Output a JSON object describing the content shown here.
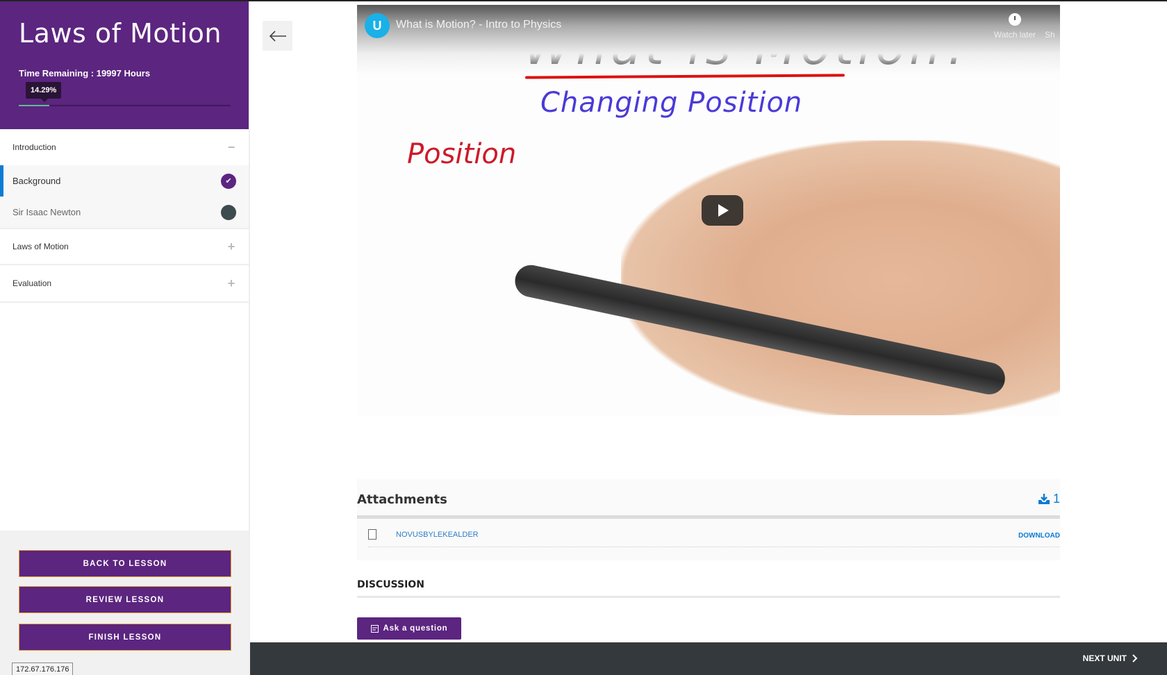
{
  "sidebar": {
    "title": "Laws of Motion",
    "time_remaining": "Time Remaining : 19997 Hours",
    "progress": {
      "percent": 14.29,
      "label": "14.29%"
    },
    "sections": [
      {
        "label": "Introduction",
        "expanded": true,
        "toggle": "−",
        "units": [
          {
            "label": "Background",
            "status": "completed",
            "active": true
          },
          {
            "label": "Sir Isaac Newton",
            "status": "incomplete",
            "active": false
          }
        ]
      },
      {
        "label": "Laws of Motion",
        "expanded": false,
        "toggle": "+"
      },
      {
        "label": "Evaluation",
        "expanded": false,
        "toggle": "+"
      }
    ],
    "buttons": {
      "back_to_lesson": "BACK TO LESSON",
      "review_lesson": "REVIEW LESSON",
      "finish_lesson": "FINISH LESSON"
    },
    "ip_address": "172.67.176.176"
  },
  "video": {
    "title": "What is Motion? - Intro to Physics",
    "watch_later": "Watch later",
    "share": "Sh",
    "whiteboard": {
      "heading": "What is Motion?",
      "subheading": "Changing Position",
      "note": "Position"
    }
  },
  "attachments": {
    "title": "Attachments",
    "count": "1",
    "files": [
      {
        "name": "NOVUSBYLEKEALDER",
        "action": "DOWNLOAD"
      }
    ]
  },
  "discussion": {
    "title": "DISCUSSION",
    "ask_button": "Ask a question"
  },
  "footer": {
    "next_unit": "NEXT UNIT"
  },
  "colors": {
    "brand_purple": "#5c2580",
    "accent_blue": "#0a7bd5",
    "progress_green": "#5bbf8c",
    "button_border": "#e0a030",
    "footer_bg": "#33393c"
  }
}
